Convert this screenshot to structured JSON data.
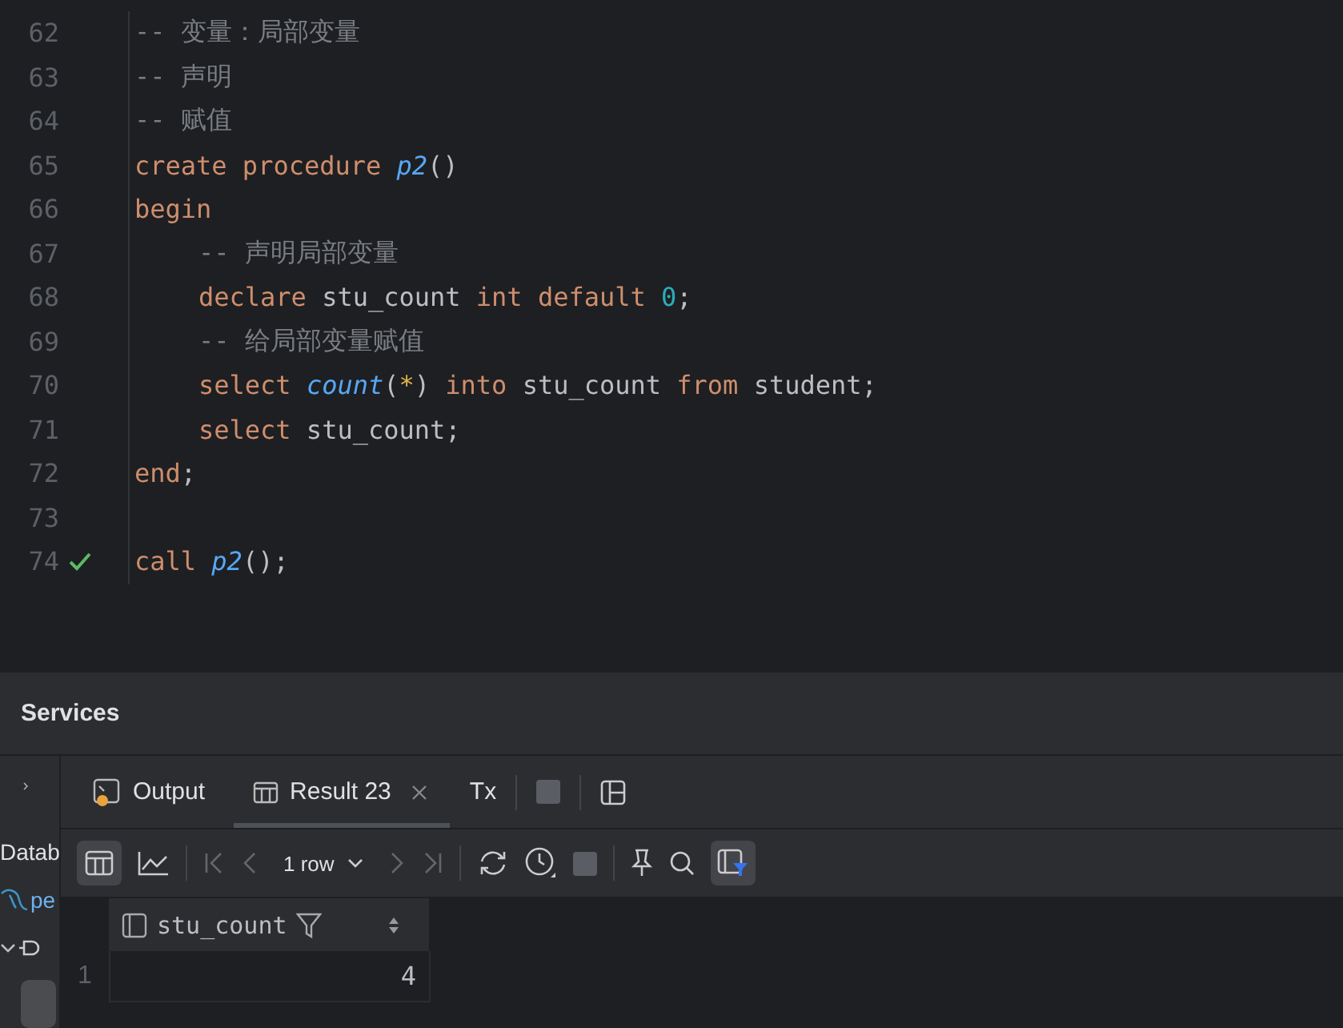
{
  "editor": {
    "lines": [
      {
        "number": "62",
        "indented": false,
        "tokens": [
          {
            "kind": "comment",
            "text": "-- 变量：局部变量"
          }
        ]
      },
      {
        "number": "63",
        "indented": false,
        "tokens": [
          {
            "kind": "comment",
            "text": "-- 声明"
          }
        ]
      },
      {
        "number": "64",
        "indented": false,
        "tokens": [
          {
            "kind": "comment",
            "text": "-- 赋值"
          }
        ]
      },
      {
        "number": "65",
        "indented": false,
        "tokens": [
          {
            "kind": "keyword",
            "text": "create procedure "
          },
          {
            "kind": "function",
            "text": "p2"
          },
          {
            "kind": "plain",
            "text": "()"
          }
        ]
      },
      {
        "number": "66",
        "indented": false,
        "tokens": [
          {
            "kind": "keyword",
            "text": "begin"
          }
        ]
      },
      {
        "number": "67",
        "indented": true,
        "tokens": [
          {
            "kind": "comment",
            "text": "-- 声明局部变量"
          }
        ]
      },
      {
        "number": "68",
        "indented": true,
        "tokens": [
          {
            "kind": "keyword",
            "text": "declare"
          },
          {
            "kind": "plain",
            "text": " stu_count "
          },
          {
            "kind": "keyword",
            "text": "int default "
          },
          {
            "kind": "number",
            "text": "0"
          },
          {
            "kind": "plain",
            "text": ";"
          }
        ]
      },
      {
        "number": "69",
        "indented": true,
        "tokens": [
          {
            "kind": "comment",
            "text": "-- 给局部变量赋值"
          }
        ]
      },
      {
        "number": "70",
        "indented": true,
        "tokens": [
          {
            "kind": "keyword",
            "text": "select "
          },
          {
            "kind": "function",
            "text": "count"
          },
          {
            "kind": "plain",
            "text": "("
          },
          {
            "kind": "star",
            "text": "*"
          },
          {
            "kind": "plain",
            "text": ") "
          },
          {
            "kind": "keyword",
            "text": "into"
          },
          {
            "kind": "plain",
            "text": " stu_count "
          },
          {
            "kind": "keyword",
            "text": "from"
          },
          {
            "kind": "plain",
            "text": " student;"
          }
        ]
      },
      {
        "number": "71",
        "indented": true,
        "tokens": [
          {
            "kind": "keyword",
            "text": "select"
          },
          {
            "kind": "plain",
            "text": " stu_count;"
          }
        ]
      },
      {
        "number": "72",
        "indented": false,
        "tokens": [
          {
            "kind": "keyword",
            "text": "end"
          },
          {
            "kind": "plain",
            "text": ";"
          }
        ]
      },
      {
        "number": "73"
      },
      {
        "number": "74",
        "indented": false,
        "executed": true,
        "tokens": [
          {
            "kind": "keyword",
            "text": "call "
          },
          {
            "kind": "function",
            "text": "p2"
          },
          {
            "kind": "plain",
            "text": "();"
          }
        ]
      }
    ]
  },
  "services": {
    "title": "Services",
    "sidebar": {
      "items": [
        {
          "kind": "text",
          "text": "Datab"
        },
        {
          "kind": "mysql",
          "text": "pe"
        },
        {
          "kind": "plug"
        }
      ]
    },
    "tabs": [
      {
        "label": "Output",
        "kind": "output",
        "selected": false
      },
      {
        "label": "Result 23",
        "kind": "result",
        "selected": true,
        "closable": true
      }
    ],
    "tx_label": "Tx",
    "toolbar": {
      "grid_view_selected": true,
      "row_count": "1 row",
      "filter_selected": true
    },
    "table": {
      "columns": [
        "stu_count"
      ],
      "rows": [
        {
          "number": "1",
          "cells": [
            "4"
          ]
        }
      ]
    }
  }
}
